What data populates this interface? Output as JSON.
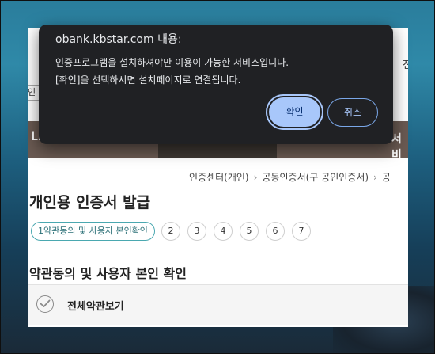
{
  "dialog": {
    "title": "obank.kbstar.com 내용:",
    "message_line1": "인증프로그램을 설치하셔야만 이용이 가능한 서비스입니다.",
    "message_line2": "[확인]을 선택하시면 설치페이지로 연결됩니다.",
    "ok_label": "확인",
    "cancel_label": "취소"
  },
  "page": {
    "right_edge_label": "전",
    "left_edge_label": "인",
    "banner_left": "Li",
    "banner_right": "서비",
    "breadcrumb": [
      "인증센터(개인)",
      "공동인증서(구 공인인증서)",
      "공"
    ],
    "breadcrumb_sep": "›",
    "title": "개인용 인증서 발급",
    "steps": {
      "current": "1약관동의 및 사용자 본인확인",
      "others": [
        "2",
        "3",
        "4",
        "5",
        "6",
        "7"
      ]
    },
    "section_title": "약관동의 및 사용자 본인 확인",
    "agree_all_label": "전체약관보기"
  },
  "colors": {
    "dialog_bg": "#202124",
    "primary_button": "#a8c7fa",
    "step_accent": "#4aa8b0",
    "banner": "#6a5a52"
  }
}
